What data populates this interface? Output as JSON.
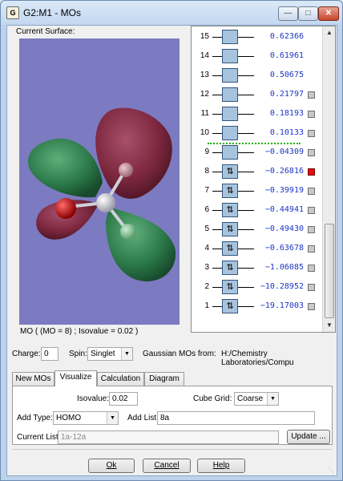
{
  "window": {
    "title": "G2:M1 - MOs",
    "app_icon": "G"
  },
  "surface": {
    "label": "Current Surface:",
    "caption": "MO ( (MO = 8) ; Isovalue = 0.02 )"
  },
  "orbitals": [
    {
      "num": "15",
      "energy": "0.62366",
      "occupied": false,
      "selectable": false,
      "selected": false
    },
    {
      "num": "14",
      "energy": "0.61961",
      "occupied": false,
      "selectable": false,
      "selected": false
    },
    {
      "num": "13",
      "energy": "0.50675",
      "occupied": false,
      "selectable": false,
      "selected": false
    },
    {
      "num": "12",
      "energy": "0.21797",
      "occupied": false,
      "selectable": true,
      "selected": false
    },
    {
      "num": "11",
      "energy": "0.18193",
      "occupied": false,
      "selectable": true,
      "selected": false
    },
    {
      "num": "10",
      "energy": "0.10133",
      "occupied": false,
      "selectable": true,
      "selected": false
    },
    {
      "num": "9",
      "energy": "−0.04309",
      "occupied": false,
      "selectable": true,
      "selected": false
    },
    {
      "num": "8",
      "energy": "−0.26816",
      "occupied": true,
      "selectable": true,
      "selected": true
    },
    {
      "num": "7",
      "energy": "−0.39919",
      "occupied": true,
      "selectable": true,
      "selected": false
    },
    {
      "num": "6",
      "energy": "−0.44941",
      "occupied": true,
      "selectable": true,
      "selected": false
    },
    {
      "num": "5",
      "energy": "−0.49430",
      "occupied": true,
      "selectable": true,
      "selected": false
    },
    {
      "num": "4",
      "energy": "−0.63678",
      "occupied": true,
      "selectable": true,
      "selected": false
    },
    {
      "num": "3",
      "energy": "−1.06085",
      "occupied": true,
      "selectable": true,
      "selected": false
    },
    {
      "num": "2",
      "energy": "−10.28952",
      "occupied": true,
      "selectable": true,
      "selected": false
    },
    {
      "num": "1",
      "energy": "−19.17003",
      "occupied": true,
      "selectable": true,
      "selected": false
    }
  ],
  "occupied_glyph": "⇅",
  "charge": {
    "label": "Charge:",
    "value": "0"
  },
  "spin": {
    "label": "Spin:",
    "value": "Singlet"
  },
  "source": {
    "label": "Gaussian MOs from:",
    "path": "H:/Chemistry Laboratories/Compu"
  },
  "tabs": [
    "New MOs",
    "Visualize",
    "Calculation",
    "Diagram"
  ],
  "visualize": {
    "isovalue_label": "Isovalue:",
    "isovalue": "0.02",
    "cube_grid_label": "Cube Grid:",
    "cube_grid": "Coarse",
    "add_type_label": "Add Type:",
    "add_type": "HOMO",
    "add_list_label": "Add List:",
    "add_list": "8a",
    "current_list_label": "Current List:",
    "current_list": "1a-12a",
    "update_label": "Update ..."
  },
  "buttons": {
    "ok": "Ok",
    "cancel": "Cancel",
    "help": "Help"
  },
  "colors": {
    "surface_bg": "#7c7ac0",
    "lobe_red": "#7e2840",
    "lobe_green": "#2c7a4a",
    "energy_blue": "#1c35c4",
    "selected_red": "#e01010",
    "homo_dots": "#1fb000"
  }
}
